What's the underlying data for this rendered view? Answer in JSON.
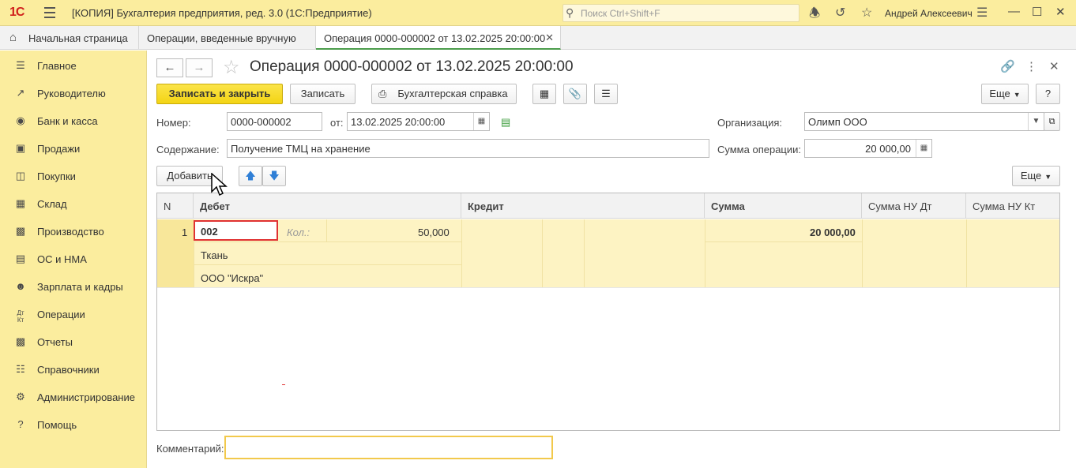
{
  "titlebar": {
    "logo": "1С",
    "title": "[КОПИЯ] Бухгалтерия предприятия, ред. 3.0  (1С:Предприятие)",
    "search_placeholder": "Поиск Ctrl+Shift+F",
    "user": "Андрей Алексеевич"
  },
  "tabs": [
    {
      "label": "Начальная страница"
    },
    {
      "label": "Операции, введенные вручную"
    },
    {
      "label": "Операция 0000-000002 от 13.02.2025 20:00:00"
    }
  ],
  "sidebar": {
    "items": [
      {
        "icon": "list-icon",
        "label": "Главное"
      },
      {
        "icon": "trend-icon",
        "label": "Руководителю"
      },
      {
        "icon": "coin-icon",
        "label": "Банк и касса"
      },
      {
        "icon": "bag-icon",
        "label": "Продажи"
      },
      {
        "icon": "cart-icon",
        "label": "Покупки"
      },
      {
        "icon": "warehouse-icon",
        "label": "Склад"
      },
      {
        "icon": "factory-icon",
        "label": "Производство"
      },
      {
        "icon": "truck-icon",
        "label": "ОС и НМА"
      },
      {
        "icon": "person-icon",
        "label": "Зарплата и кадры"
      },
      {
        "icon": "dt-kt-icon",
        "label": "Операции"
      },
      {
        "icon": "bar-chart-icon",
        "label": "Отчеты"
      },
      {
        "icon": "book-icon",
        "label": "Справочники"
      },
      {
        "icon": "gear-icon",
        "label": "Администрирование"
      },
      {
        "icon": "question-icon",
        "label": "Помощь"
      }
    ]
  },
  "form": {
    "title": "Операция 0000-000002 от 13.02.2025 20:00:00",
    "buttons": {
      "save_close": "Записать и закрыть",
      "save": "Записать",
      "accounting_note": "Бухгалтерская справка",
      "more": "Еще",
      "help": "?",
      "add": "Добавить",
      "more2": "Еще"
    },
    "fields": {
      "number_label": "Номер:",
      "number_value": "0000-000002",
      "date_label": "от:",
      "date_value": "13.02.2025 20:00:00",
      "org_label": "Организация:",
      "org_value": "Олимп ООО",
      "content_label": "Содержание:",
      "content_value": "Получение ТМЦ на хранение",
      "sum_label": "Сумма операции:",
      "sum_value": "20 000,00",
      "comment_label": "Комментарий:",
      "comment_value": ""
    },
    "table": {
      "headers": {
        "n": "N",
        "debit": "Дебет",
        "credit": "Кредит",
        "sum": "Сумма",
        "sum_nu_dt": "Сумма НУ Дт",
        "sum_nu_kt": "Сумма НУ Кт"
      },
      "rows": [
        {
          "n": "1",
          "debit_account": "002",
          "qty_label": "Кол.:",
          "qty_value": "50,000",
          "subconto1": "Ткань",
          "subconto2": "ООО \"Искра\"",
          "sum": "20 000,00"
        }
      ]
    }
  }
}
